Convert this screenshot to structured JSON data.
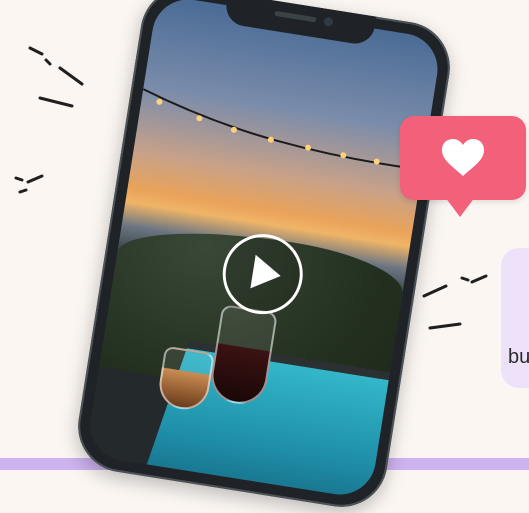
{
  "side_text": "bu",
  "phone": {
    "video": {
      "play_label": "Play video"
    }
  },
  "like": {
    "icon": "heart-icon",
    "color": "#f2607a"
  },
  "colors": {
    "background": "#fbf6f2",
    "bottom_bar": "#cdb3ef",
    "phone_frame": "#1f2327"
  }
}
